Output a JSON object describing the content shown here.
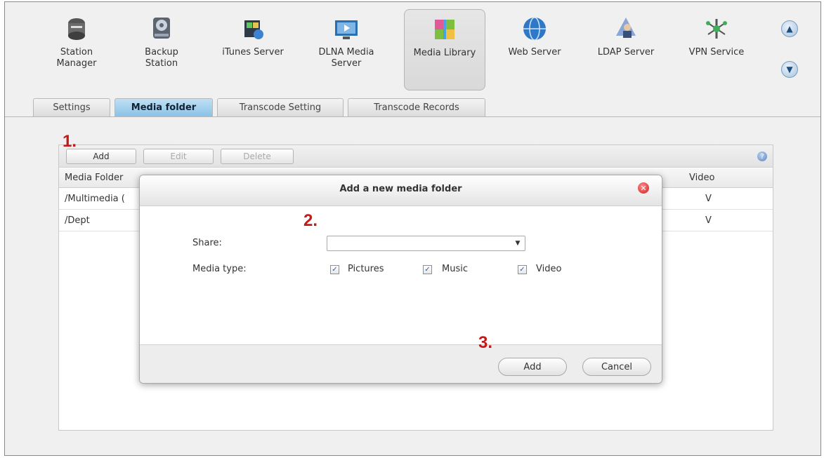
{
  "apps": [
    {
      "label": "Station\nManager",
      "icon": "station-manager-icon"
    },
    {
      "label": "Backup\nStation",
      "icon": "backup-station-icon"
    },
    {
      "label": "iTunes Server",
      "icon": "itunes-server-icon"
    },
    {
      "label": "DLNA Media\nServer",
      "icon": "dlna-server-icon"
    },
    {
      "label": "Media Library",
      "icon": "media-library-icon",
      "active": true
    },
    {
      "label": "Web Server",
      "icon": "web-server-icon"
    },
    {
      "label": "LDAP Server",
      "icon": "ldap-server-icon"
    },
    {
      "label": "VPN Service",
      "icon": "vpn-service-icon"
    }
  ],
  "nav": {
    "up": "▲",
    "down": "▼"
  },
  "tabs": [
    {
      "label": "Settings"
    },
    {
      "label": "Media folder",
      "active": true
    },
    {
      "label": "Transcode Setting"
    },
    {
      "label": "Transcode Records"
    }
  ],
  "toolbar": {
    "add": "Add",
    "edit": "Edit",
    "delete": "Delete",
    "help": "?"
  },
  "table": {
    "columns": [
      "Media Folder",
      "Video"
    ],
    "rows": [
      {
        "folder": "/Multimedia (",
        "video": "V"
      },
      {
        "folder": "/Dept",
        "video": "V"
      }
    ]
  },
  "dialog": {
    "title": "Add a new media folder",
    "close": "✕",
    "share_label": "Share:",
    "share_value": "",
    "media_type_label": "Media type:",
    "media_types": [
      {
        "label": "Pictures",
        "checked": true
      },
      {
        "label": "Music",
        "checked": true
      },
      {
        "label": "Video",
        "checked": true
      }
    ],
    "add_button": "Add",
    "cancel_button": "Cancel",
    "check_glyph": "✓",
    "select_arrow": "▼"
  },
  "steps": [
    "1.",
    "2.",
    "3."
  ],
  "colors": {
    "accent_tab": "#8ac2e6",
    "step_marker": "#c41a1a"
  }
}
